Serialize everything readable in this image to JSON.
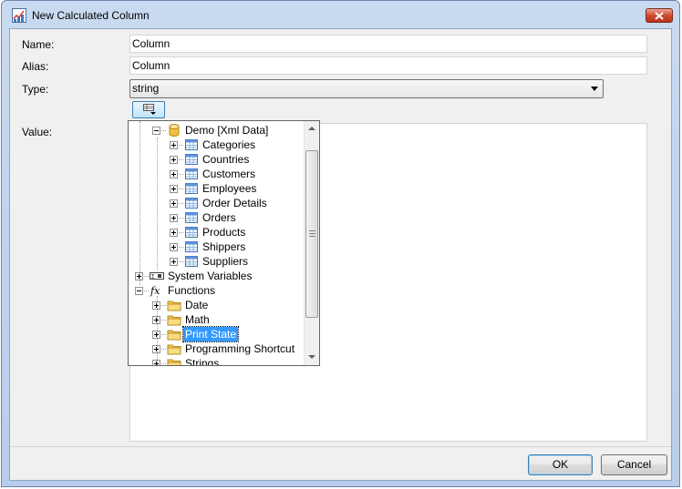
{
  "window": {
    "title": "New Calculated Column"
  },
  "form": {
    "name_label": "Name:",
    "name_value": "Column",
    "alias_label": "Alias:",
    "alias_value": "Column",
    "type_label": "Type:",
    "type_value": "string",
    "value_label": "Value:"
  },
  "tree": {
    "items": [
      {
        "label": "Demo [Xml Data]",
        "icon": "database-icon",
        "level": 1,
        "state": "expanded"
      },
      {
        "label": "Categories",
        "icon": "table-icon",
        "level": 2,
        "state": "collapsed"
      },
      {
        "label": "Countries",
        "icon": "table-icon",
        "level": 2,
        "state": "collapsed"
      },
      {
        "label": "Customers",
        "icon": "table-icon",
        "level": 2,
        "state": "collapsed"
      },
      {
        "label": "Employees",
        "icon": "table-icon",
        "level": 2,
        "state": "collapsed"
      },
      {
        "label": "Order Details",
        "icon": "table-icon",
        "level": 2,
        "state": "collapsed"
      },
      {
        "label": "Orders",
        "icon": "table-icon",
        "level": 2,
        "state": "collapsed"
      },
      {
        "label": "Products",
        "icon": "table-icon",
        "level": 2,
        "state": "collapsed"
      },
      {
        "label": "Shippers",
        "icon": "table-icon",
        "level": 2,
        "state": "collapsed"
      },
      {
        "label": "Suppliers",
        "icon": "table-icon",
        "level": 2,
        "state": "collapsed"
      },
      {
        "label": "System Variables",
        "icon": "system-variables-icon",
        "level": 0,
        "state": "collapsed"
      },
      {
        "label": "Functions",
        "icon": "function-icon",
        "level": 0,
        "state": "expanded"
      },
      {
        "label": "Date",
        "icon": "folder-icon",
        "level": 1,
        "state": "collapsed"
      },
      {
        "label": "Math",
        "icon": "folder-icon",
        "level": 1,
        "state": "collapsed"
      },
      {
        "label": "Print State",
        "icon": "folder-icon",
        "level": 1,
        "state": "collapsed",
        "selected": true
      },
      {
        "label": "Programming Shortcut",
        "icon": "folder-icon",
        "level": 1,
        "state": "collapsed"
      },
      {
        "label": "Strings",
        "icon": "folder-icon",
        "level": 1,
        "state": "collapsed"
      }
    ]
  },
  "buttons": {
    "ok": "OK",
    "cancel": "Cancel"
  },
  "colors": {
    "selection": "#3399ff",
    "title_bar": "#c9daf0",
    "close_button": "#cf4b31"
  }
}
